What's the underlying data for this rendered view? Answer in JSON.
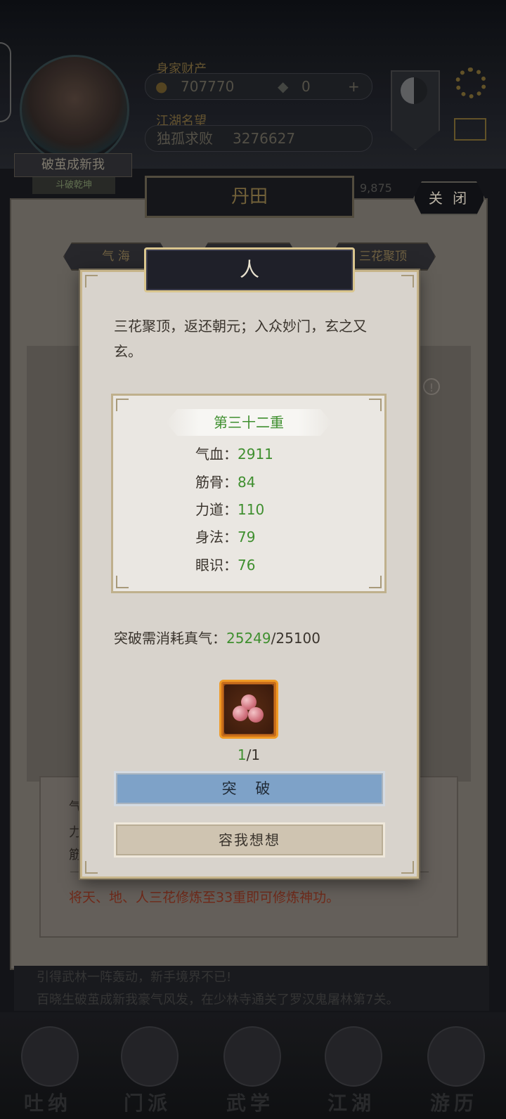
{
  "header": {
    "wealth_label": "身家财产",
    "gold": "707770",
    "gems": "0",
    "plus": "+",
    "fame_label": "江湖名望",
    "fame_title": "独孤求败",
    "fame_value": "3276627",
    "avatar_title": "破茧成新我",
    "avatar_sub": "斗破乾坤"
  },
  "panel": {
    "title": "丹田",
    "close_label": "关 闭",
    "dim_number": "9,875",
    "tabs": [
      "气 海",
      "",
      "三花聚顶"
    ],
    "info_icon": "!",
    "bottom_lines": [
      "气",
      "力",
      "筋"
    ],
    "red_note": "将天、地、人三花修炼至33重即可修炼神功。"
  },
  "news": {
    "lines": [
      "引得武林一阵轰动，新手境界不已!",
      "百晓生破茧成新我豪气风发，在少林寺通关了罗汉鬼屠林第7关。"
    ]
  },
  "nav": {
    "items": [
      "吐纳",
      "门派",
      "武学",
      "江湖",
      "游历"
    ]
  },
  "modal": {
    "title": "人",
    "description": "三花聚顶，返还朝元；入众妙门，玄之又玄。",
    "stage": "第三十二重",
    "stats": [
      {
        "label": "气血：",
        "value": "2911"
      },
      {
        "label": "筋骨：",
        "value": "84"
      },
      {
        "label": "力道：",
        "value": "110"
      },
      {
        "label": "身法：",
        "value": "79"
      },
      {
        "label": "眼识：",
        "value": "76"
      }
    ],
    "cost_label": "突破需消耗真气：",
    "cost_current": "25249",
    "cost_required": "/25100",
    "item_owned": "1",
    "item_needed": "/1",
    "breakthrough_label": "突 破",
    "cancel_label": "容我想想"
  },
  "colors": {
    "accent_green": "#3f8f2f",
    "break_button": "#7ea2c8",
    "note_red": "#7a2e1d",
    "item_border": "#f09a25"
  }
}
